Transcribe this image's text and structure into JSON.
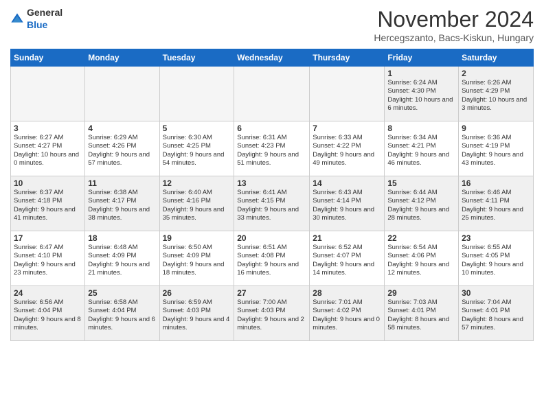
{
  "header": {
    "logo_general": "General",
    "logo_blue": "Blue",
    "month_title": "November 2024",
    "location": "Hercegszanto, Bacs-Kiskun, Hungary"
  },
  "days_of_week": [
    "Sunday",
    "Monday",
    "Tuesday",
    "Wednesday",
    "Thursday",
    "Friday",
    "Saturday"
  ],
  "weeks": [
    [
      {
        "day": "",
        "info": "",
        "empty": true
      },
      {
        "day": "",
        "info": "",
        "empty": true
      },
      {
        "day": "",
        "info": "",
        "empty": true
      },
      {
        "day": "",
        "info": "",
        "empty": true
      },
      {
        "day": "",
        "info": "",
        "empty": true
      },
      {
        "day": "1",
        "info": "Sunrise: 6:24 AM\nSunset: 4:30 PM\nDaylight: 10 hours and 6 minutes."
      },
      {
        "day": "2",
        "info": "Sunrise: 6:26 AM\nSunset: 4:29 PM\nDaylight: 10 hours and 3 minutes."
      }
    ],
    [
      {
        "day": "3",
        "info": "Sunrise: 6:27 AM\nSunset: 4:27 PM\nDaylight: 10 hours and 0 minutes."
      },
      {
        "day": "4",
        "info": "Sunrise: 6:29 AM\nSunset: 4:26 PM\nDaylight: 9 hours and 57 minutes."
      },
      {
        "day": "5",
        "info": "Sunrise: 6:30 AM\nSunset: 4:25 PM\nDaylight: 9 hours and 54 minutes."
      },
      {
        "day": "6",
        "info": "Sunrise: 6:31 AM\nSunset: 4:23 PM\nDaylight: 9 hours and 51 minutes."
      },
      {
        "day": "7",
        "info": "Sunrise: 6:33 AM\nSunset: 4:22 PM\nDaylight: 9 hours and 49 minutes."
      },
      {
        "day": "8",
        "info": "Sunrise: 6:34 AM\nSunset: 4:21 PM\nDaylight: 9 hours and 46 minutes."
      },
      {
        "day": "9",
        "info": "Sunrise: 6:36 AM\nSunset: 4:19 PM\nDaylight: 9 hours and 43 minutes."
      }
    ],
    [
      {
        "day": "10",
        "info": "Sunrise: 6:37 AM\nSunset: 4:18 PM\nDaylight: 9 hours and 41 minutes."
      },
      {
        "day": "11",
        "info": "Sunrise: 6:38 AM\nSunset: 4:17 PM\nDaylight: 9 hours and 38 minutes."
      },
      {
        "day": "12",
        "info": "Sunrise: 6:40 AM\nSunset: 4:16 PM\nDaylight: 9 hours and 35 minutes."
      },
      {
        "day": "13",
        "info": "Sunrise: 6:41 AM\nSunset: 4:15 PM\nDaylight: 9 hours and 33 minutes."
      },
      {
        "day": "14",
        "info": "Sunrise: 6:43 AM\nSunset: 4:14 PM\nDaylight: 9 hours and 30 minutes."
      },
      {
        "day": "15",
        "info": "Sunrise: 6:44 AM\nSunset: 4:12 PM\nDaylight: 9 hours and 28 minutes."
      },
      {
        "day": "16",
        "info": "Sunrise: 6:46 AM\nSunset: 4:11 PM\nDaylight: 9 hours and 25 minutes."
      }
    ],
    [
      {
        "day": "17",
        "info": "Sunrise: 6:47 AM\nSunset: 4:10 PM\nDaylight: 9 hours and 23 minutes."
      },
      {
        "day": "18",
        "info": "Sunrise: 6:48 AM\nSunset: 4:09 PM\nDaylight: 9 hours and 21 minutes."
      },
      {
        "day": "19",
        "info": "Sunrise: 6:50 AM\nSunset: 4:09 PM\nDaylight: 9 hours and 18 minutes."
      },
      {
        "day": "20",
        "info": "Sunrise: 6:51 AM\nSunset: 4:08 PM\nDaylight: 9 hours and 16 minutes."
      },
      {
        "day": "21",
        "info": "Sunrise: 6:52 AM\nSunset: 4:07 PM\nDaylight: 9 hours and 14 minutes."
      },
      {
        "day": "22",
        "info": "Sunrise: 6:54 AM\nSunset: 4:06 PM\nDaylight: 9 hours and 12 minutes."
      },
      {
        "day": "23",
        "info": "Sunrise: 6:55 AM\nSunset: 4:05 PM\nDaylight: 9 hours and 10 minutes."
      }
    ],
    [
      {
        "day": "24",
        "info": "Sunrise: 6:56 AM\nSunset: 4:04 PM\nDaylight: 9 hours and 8 minutes."
      },
      {
        "day": "25",
        "info": "Sunrise: 6:58 AM\nSunset: 4:04 PM\nDaylight: 9 hours and 6 minutes."
      },
      {
        "day": "26",
        "info": "Sunrise: 6:59 AM\nSunset: 4:03 PM\nDaylight: 9 hours and 4 minutes."
      },
      {
        "day": "27",
        "info": "Sunrise: 7:00 AM\nSunset: 4:03 PM\nDaylight: 9 hours and 2 minutes."
      },
      {
        "day": "28",
        "info": "Sunrise: 7:01 AM\nSunset: 4:02 PM\nDaylight: 9 hours and 0 minutes."
      },
      {
        "day": "29",
        "info": "Sunrise: 7:03 AM\nSunset: 4:01 PM\nDaylight: 8 hours and 58 minutes."
      },
      {
        "day": "30",
        "info": "Sunrise: 7:04 AM\nSunset: 4:01 PM\nDaylight: 8 hours and 57 minutes."
      }
    ]
  ]
}
